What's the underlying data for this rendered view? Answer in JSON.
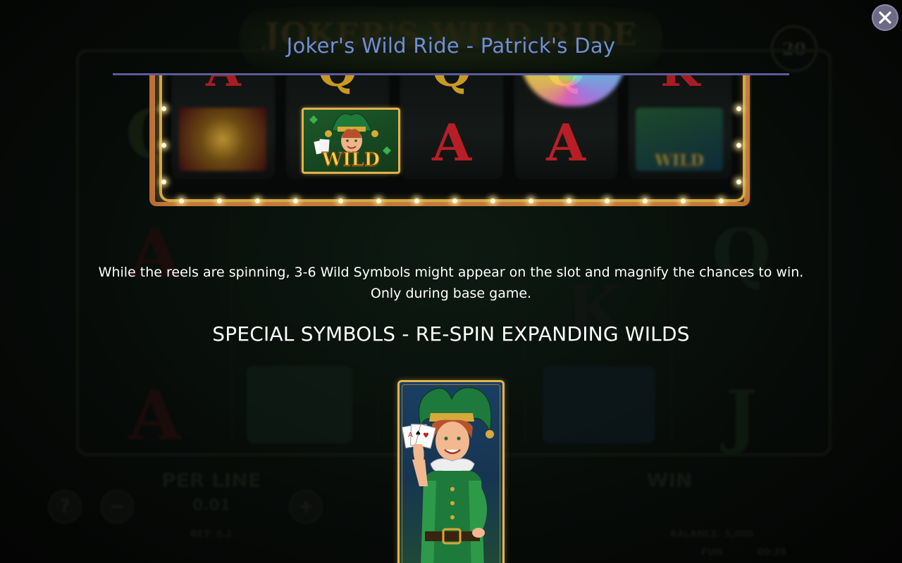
{
  "background_game": {
    "logo_text": "JOKER'S WILD RIDE",
    "lines_badge": "20",
    "grid_rows": [
      [
        "Q",
        "",
        "",
        "",
        "Q"
      ],
      [
        "A",
        "",
        "",
        "K",
        ""
      ],
      [
        "A",
        "",
        "",
        "",
        "J"
      ]
    ],
    "per_line_label": "PER LINE",
    "per_line_value": "0.01",
    "win_label": "WIN",
    "help_label": "?",
    "minus_label": "−",
    "plus_label": "+",
    "bet_text": "BET: 0.2",
    "balance_text": "BALANCE: 5,000",
    "mode_text": "FUN",
    "clock_text": "00:38"
  },
  "modal": {
    "title": "Joker's Wild Ride - Patrick's Day",
    "close_icon": "close-icon",
    "reel_preview": {
      "columns": [
        {
          "top": "A"
        },
        {
          "top": "Q"
        },
        {
          "top": "Q",
          "bottom": "A"
        },
        {
          "top": "Q",
          "bottom": "A"
        },
        {
          "top": "K"
        }
      ],
      "wild_label": "WILD",
      "faded_wild_label": "WILD"
    },
    "description_line1": "While the reels are spinning, 3-6 Wild Symbols might appear on the slot and magnify the chances to win.",
    "description_line2": "Only during base game.",
    "section_title": "SPECIAL SYMBOLS - RE-SPIN EXPANDING WILDS"
  },
  "colors": {
    "title_blue": "#6f8fd6",
    "rule": "#5c5c97",
    "gold": "#e4b24c",
    "close_bg": "#6d6a86"
  }
}
